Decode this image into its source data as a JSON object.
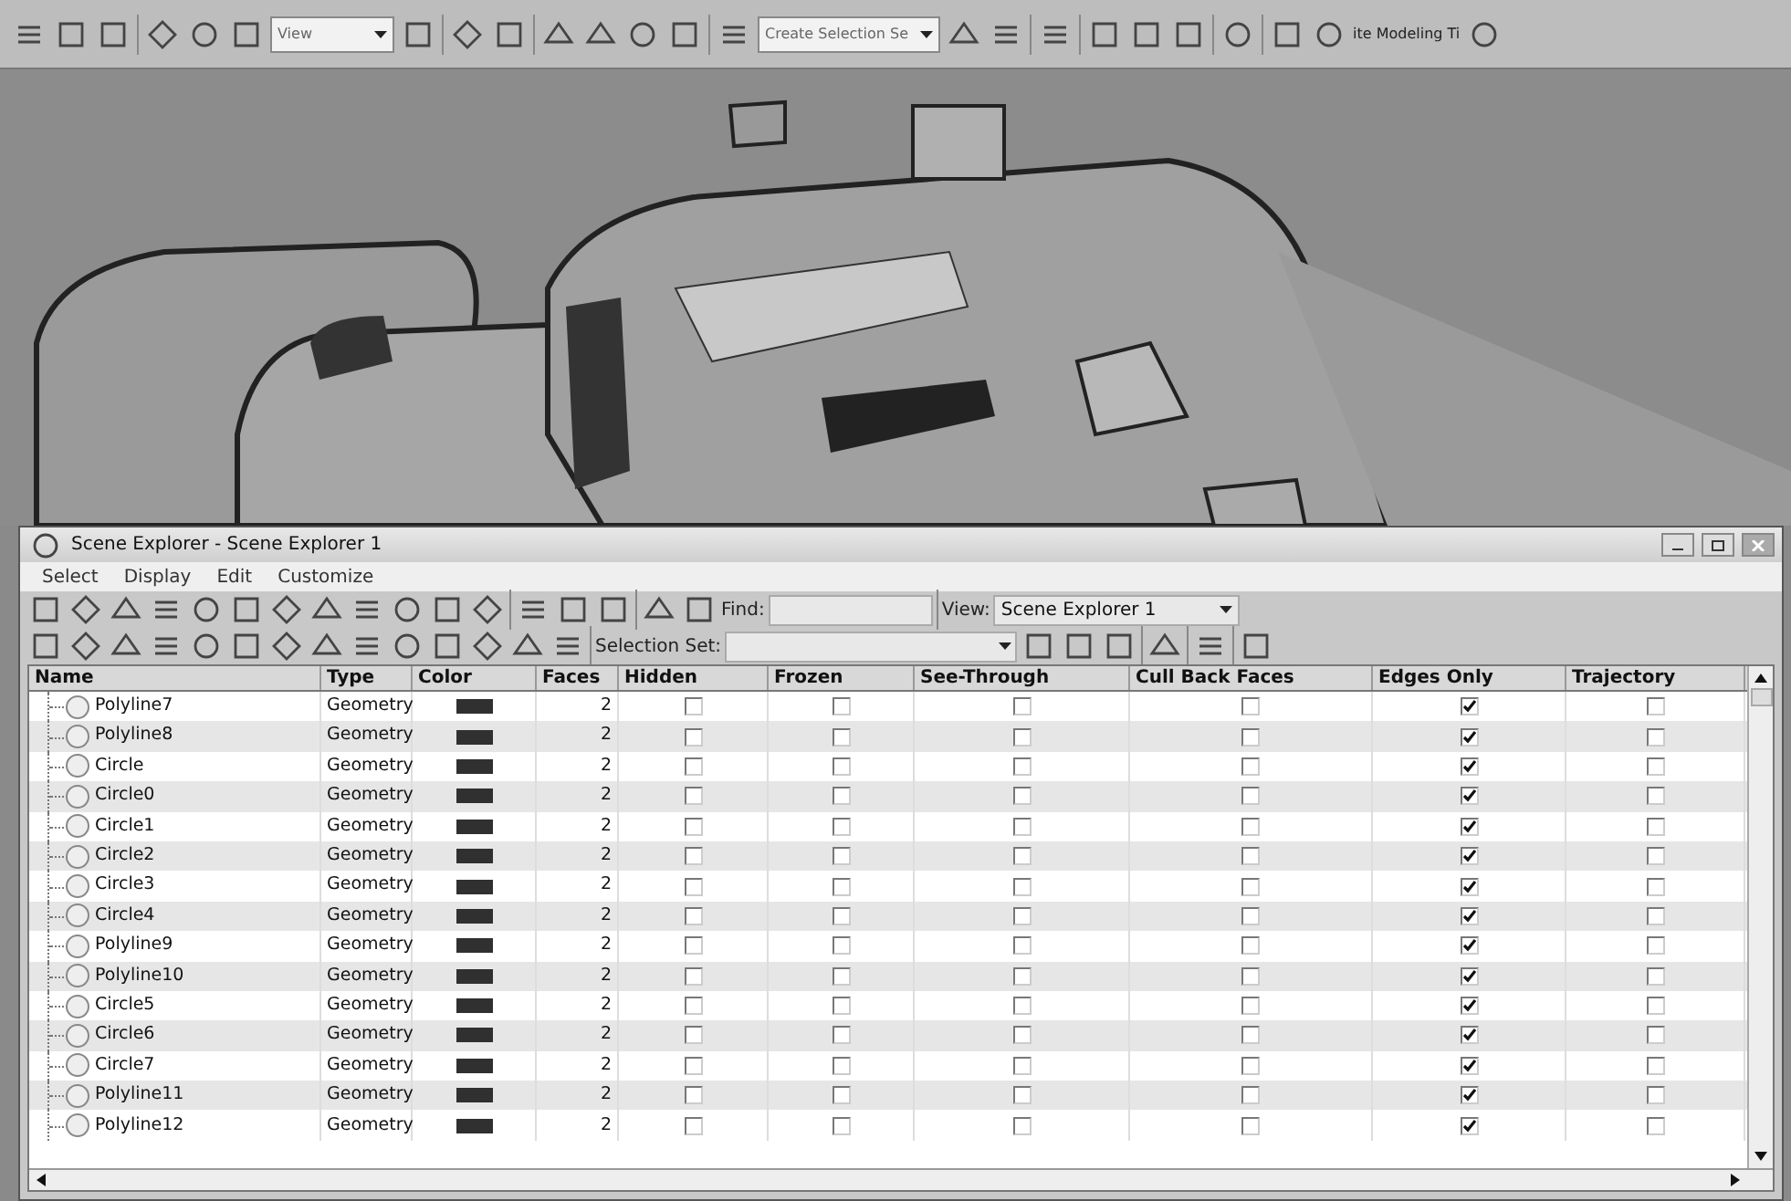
{
  "main_toolbar": {
    "view_dropdown": "View",
    "selection_set_dropdown": "Create Selection Se",
    "cut_label": "ite Modeling Ti"
  },
  "scene_explorer": {
    "title": "Scene Explorer - Scene Explorer 1",
    "menu": [
      "Select",
      "Display",
      "Edit",
      "Customize"
    ],
    "find_label": "Find:",
    "view_label": "View:",
    "view_value": "Scene Explorer 1",
    "selection_set_label": "Selection Set:",
    "columns": [
      "Name",
      "Type",
      "Color",
      "Faces",
      "Hidden",
      "Frozen",
      "See-Through",
      "Cull Back Faces",
      "Edges Only",
      "Trajectory"
    ],
    "rows": [
      {
        "name": "Polyline7",
        "type": "Geometry",
        "color": "#303030",
        "faces": "2",
        "hidden": false,
        "frozen": false,
        "see_through": false,
        "cull_back_faces": false,
        "edges_only": true,
        "trajectory": false
      },
      {
        "name": "Polyline8",
        "type": "Geometry",
        "color": "#303030",
        "faces": "2",
        "hidden": false,
        "frozen": false,
        "see_through": false,
        "cull_back_faces": false,
        "edges_only": true,
        "trajectory": false
      },
      {
        "name": "Circle",
        "type": "Geometry",
        "color": "#303030",
        "faces": "2",
        "hidden": false,
        "frozen": false,
        "see_through": false,
        "cull_back_faces": false,
        "edges_only": true,
        "trajectory": false
      },
      {
        "name": "Circle0",
        "type": "Geometry",
        "color": "#303030",
        "faces": "2",
        "hidden": false,
        "frozen": false,
        "see_through": false,
        "cull_back_faces": false,
        "edges_only": true,
        "trajectory": false
      },
      {
        "name": "Circle1",
        "type": "Geometry",
        "color": "#303030",
        "faces": "2",
        "hidden": false,
        "frozen": false,
        "see_through": false,
        "cull_back_faces": false,
        "edges_only": true,
        "trajectory": false
      },
      {
        "name": "Circle2",
        "type": "Geometry",
        "color": "#303030",
        "faces": "2",
        "hidden": false,
        "frozen": false,
        "see_through": false,
        "cull_back_faces": false,
        "edges_only": true,
        "trajectory": false
      },
      {
        "name": "Circle3",
        "type": "Geometry",
        "color": "#303030",
        "faces": "2",
        "hidden": false,
        "frozen": false,
        "see_through": false,
        "cull_back_faces": false,
        "edges_only": true,
        "trajectory": false
      },
      {
        "name": "Circle4",
        "type": "Geometry",
        "color": "#303030",
        "faces": "2",
        "hidden": false,
        "frozen": false,
        "see_through": false,
        "cull_back_faces": false,
        "edges_only": true,
        "trajectory": false
      },
      {
        "name": "Polyline9",
        "type": "Geometry",
        "color": "#303030",
        "faces": "2",
        "hidden": false,
        "frozen": false,
        "see_through": false,
        "cull_back_faces": false,
        "edges_only": true,
        "trajectory": false
      },
      {
        "name": "Polyline10",
        "type": "Geometry",
        "color": "#303030",
        "faces": "2",
        "hidden": false,
        "frozen": false,
        "see_through": false,
        "cull_back_faces": false,
        "edges_only": true,
        "trajectory": false
      },
      {
        "name": "Circle5",
        "type": "Geometry",
        "color": "#303030",
        "faces": "2",
        "hidden": false,
        "frozen": false,
        "see_through": false,
        "cull_back_faces": false,
        "edges_only": true,
        "trajectory": false
      },
      {
        "name": "Circle6",
        "type": "Geometry",
        "color": "#303030",
        "faces": "2",
        "hidden": false,
        "frozen": false,
        "see_through": false,
        "cull_back_faces": false,
        "edges_only": true,
        "trajectory": false
      },
      {
        "name": "Circle7",
        "type": "Geometry",
        "color": "#303030",
        "faces": "2",
        "hidden": false,
        "frozen": false,
        "see_through": false,
        "cull_back_faces": false,
        "edges_only": true,
        "trajectory": false
      },
      {
        "name": "Polyline11",
        "type": "Geometry",
        "color": "#303030",
        "faces": "2",
        "hidden": false,
        "frozen": false,
        "see_through": false,
        "cull_back_faces": false,
        "edges_only": true,
        "trajectory": false
      },
      {
        "name": "Polyline12",
        "type": "Geometry",
        "color": "#303030",
        "faces": "2",
        "hidden": false,
        "frozen": false,
        "see_through": false,
        "cull_back_faces": false,
        "edges_only": true,
        "trajectory": false
      }
    ]
  }
}
